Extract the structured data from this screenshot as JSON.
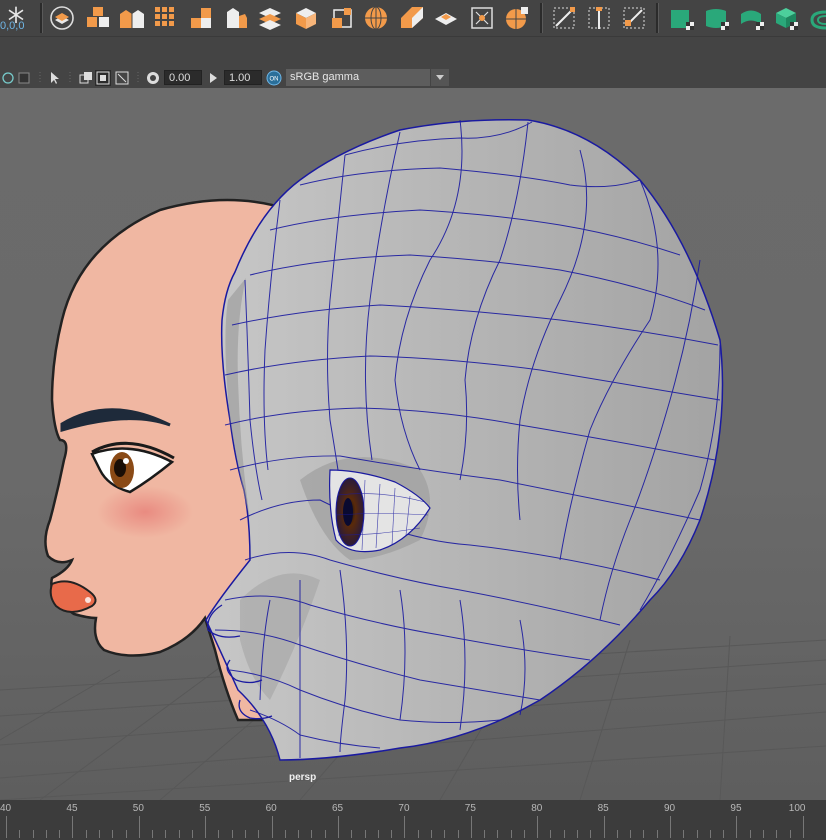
{
  "shelf": {
    "coord_label": "0,0,0",
    "buttons": [
      "snowflake-icon",
      "circle-plane-icon",
      "cube-split-icon",
      "cube-mirror-icon",
      "grid-icon",
      "cube-combine-icon",
      "cube-separate-icon",
      "plane-layers-icon",
      "cube-open-icon",
      "cube-extract-icon",
      "sphere-icon",
      "bevel-icon",
      "bridge-icon",
      "target-icon",
      "sphere-grid-icon",
      "multi-cut-icon",
      "insert-edge-icon",
      "target-weld-icon",
      "green-cube-icon",
      "green-shell-icon",
      "green-tube-icon",
      "green-cube-check-icon",
      "green-curve-icon"
    ]
  },
  "viewbar": {
    "exposure": "0.00",
    "gamma": "1.00",
    "colorspace": "sRGB gamma",
    "colorspace_badge": "ON"
  },
  "viewport": {
    "camera": "persp"
  },
  "timeline": {
    "ticks": [
      "40",
      "45",
      "50",
      "55",
      "60",
      "65",
      "70",
      "75",
      "80",
      "85",
      "90",
      "95",
      "100"
    ]
  }
}
